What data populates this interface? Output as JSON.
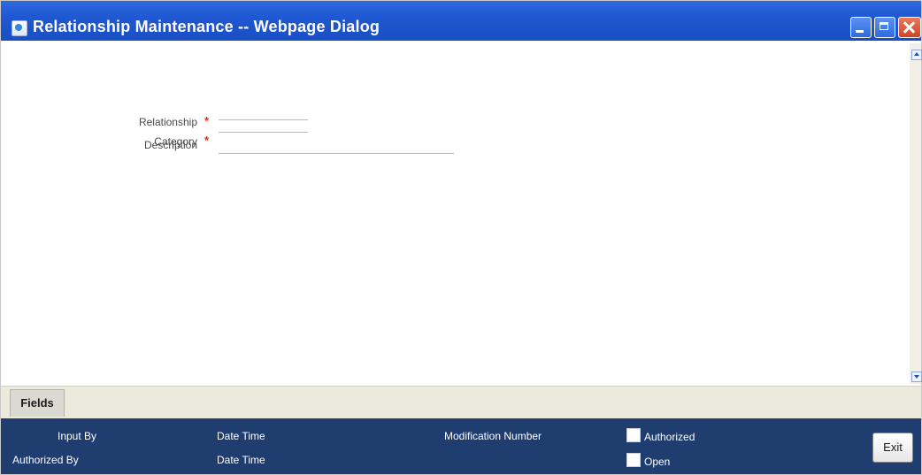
{
  "window": {
    "title": "Relationship Maintenance -- Webpage Dialog",
    "controls": {
      "minimize": "minimize-icon",
      "maximize": "maximize-icon",
      "close": "close-icon"
    }
  },
  "form": {
    "relationship": {
      "label": "Relationship",
      "required_mark": "*",
      "value": ""
    },
    "category": {
      "label": "Category",
      "required_mark": "*",
      "value": ""
    },
    "description": {
      "label": "Description",
      "value": ""
    }
  },
  "tabs": {
    "fields": "Fields"
  },
  "footer": {
    "input_by": "Input By",
    "date_time_1": "Date Time",
    "authorized_by": "Authorized By",
    "date_time_2": "Date Time",
    "modification_number": "Modification Number",
    "authorized": "Authorized",
    "open": "Open",
    "exit": "Exit"
  },
  "colors": {
    "titlebar": "#1f58d2",
    "footer": "#1f3d6e",
    "required": "#e03010"
  }
}
